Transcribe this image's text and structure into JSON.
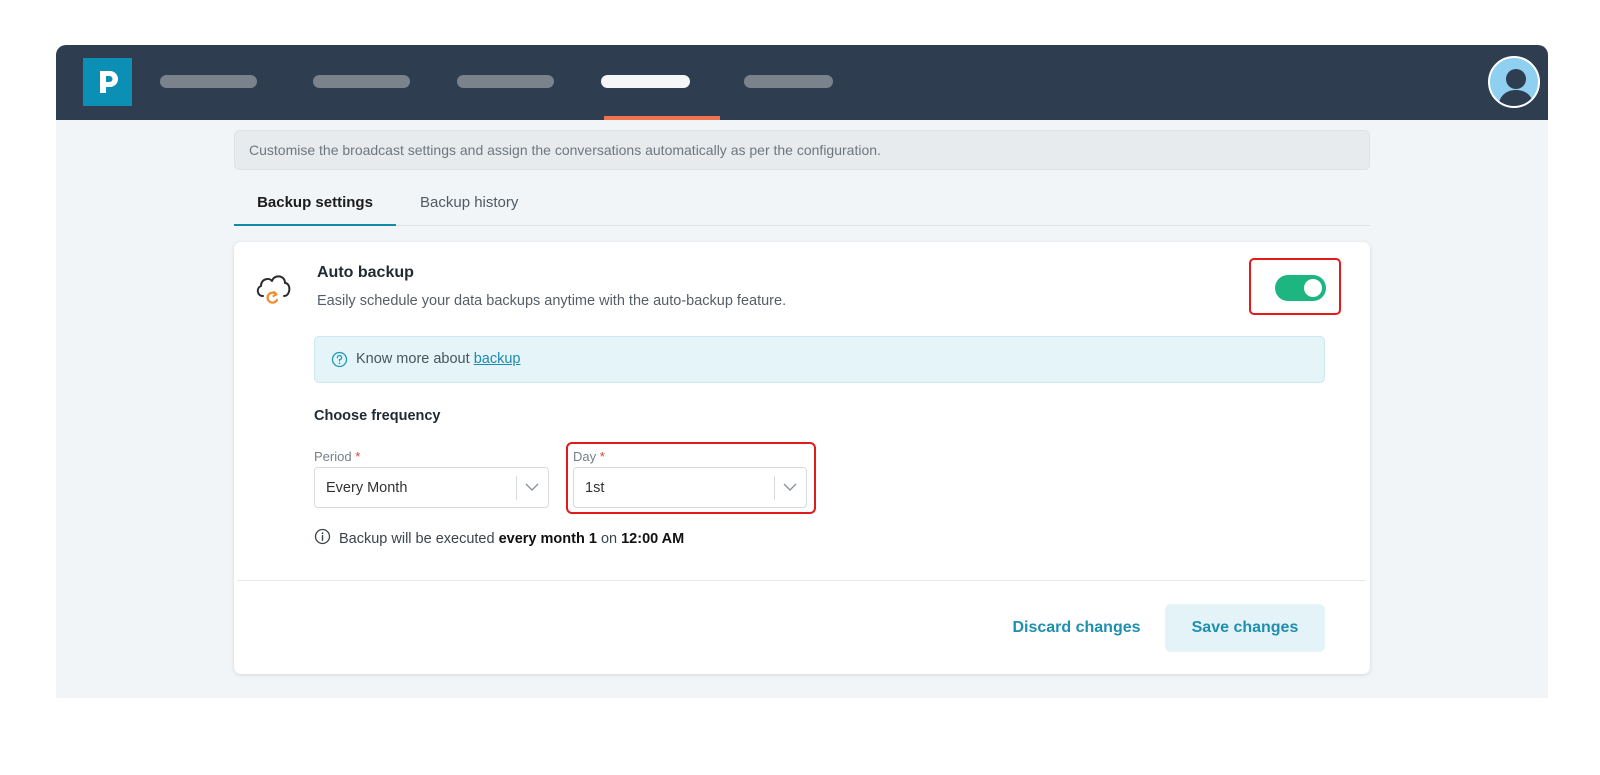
{
  "icons": {
    "logo": "p-logo-icon",
    "avatar": "user-avatar-icon",
    "backup": "cloud-sync-icon",
    "help": "question-circle-icon",
    "info": "info-circle-icon",
    "dropdown": "chevron-down-icon"
  },
  "colors": {
    "topbar": "#2e3e50",
    "accent": "#138aa8",
    "nav_active_indicator": "#f0724f",
    "toggle_on": "#1db681",
    "highlight_box": "#e21a1a"
  },
  "description": "Customise the broadcast settings and assign the conversations automatically as per the configuration.",
  "tabs": [
    {
      "label": "Backup settings",
      "active": true
    },
    {
      "label": "Backup history",
      "active": false
    }
  ],
  "auto_backup": {
    "title": "Auto backup",
    "subtitle": "Easily schedule your data backups anytime with the auto-backup feature.",
    "enabled": true
  },
  "help": {
    "text": "Know more about ",
    "link_text": "backup"
  },
  "frequency": {
    "title": "Choose frequency",
    "period": {
      "label": "Period",
      "required_mark": "*",
      "value": "Every Month"
    },
    "day": {
      "label": "Day",
      "required_mark": "*",
      "value": "1st"
    },
    "note": {
      "prefix": "Backup will be executed ",
      "schedule": "every month 1",
      "middle": " on ",
      "time": "12:00 AM"
    }
  },
  "actions": {
    "discard": "Discard changes",
    "save": "Save changes"
  }
}
